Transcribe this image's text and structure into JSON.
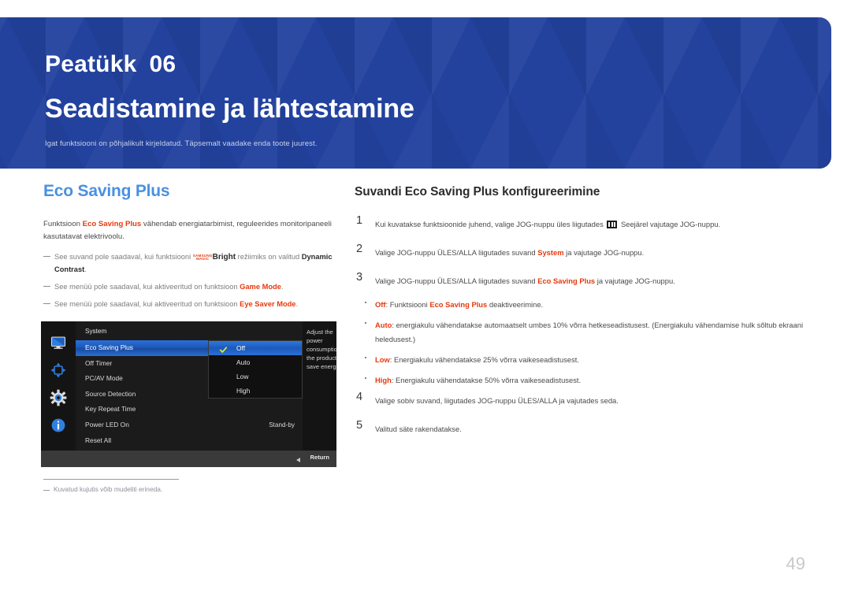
{
  "header": {
    "chapter_label": "Peatükk",
    "chapter_number": "06",
    "title": "Seadistamine ja lähtestamine",
    "subtitle": "Igat funktsiooni on põhjalikult kirjeldatud. Täpsemalt vaadake enda toote juurest.",
    "bg_color": "#23429e"
  },
  "left": {
    "heading": "Eco Saving Plus",
    "heading_color": "#4a90e2",
    "paragraph": {
      "p1": "Funktsioon ",
      "accent1": "Eco Saving Plus",
      "p2": " vähendab energiatarbimist, reguleerides monitoripaneeli kasutatavat elektrivoolu."
    },
    "notes": [
      {
        "pre": "See suvand pole saadaval, kui funktsiooni ",
        "logo_top": "SAMSUNG",
        "logo_bottom": "MAGIC",
        "logo_word": "Bright",
        "mid": " režiimiks on valitud ",
        "accent": "Dynamic Contrast",
        "post": "."
      },
      {
        "pre": "See menüü pole saadaval, kui aktiveeritud on funktsioon ",
        "accent": "Game Mode",
        "post": "."
      },
      {
        "pre": "See menüü pole saadaval, kui aktiveeritud on funktsioon ",
        "accent": "Eye Saver Mode",
        "post": "."
      }
    ],
    "footnote": "Kuvatud kujutis võib mudeliti erineda."
  },
  "osd": {
    "menu_title": "System",
    "items": [
      {
        "label": "Eco Saving Plus",
        "selected": true,
        "value": ""
      },
      {
        "label": "Off Timer",
        "selected": false,
        "value": ""
      },
      {
        "label": "PC/AV Mode",
        "selected": false,
        "value": ""
      },
      {
        "label": "Source Detection",
        "selected": false,
        "value": ""
      },
      {
        "label": "Key Repeat Time",
        "selected": false,
        "value": ""
      },
      {
        "label": "Power LED On",
        "selected": false,
        "value": "Stand-by"
      },
      {
        "label": "Reset All",
        "selected": false,
        "value": ""
      }
    ],
    "submenu": [
      {
        "label": "Off",
        "selected": true
      },
      {
        "label": "Auto",
        "selected": false
      },
      {
        "label": "Low",
        "selected": false
      },
      {
        "label": "High",
        "selected": false
      }
    ],
    "description": "Adjust the power consumption of the product to save energy.",
    "return_label": "Return",
    "icons": [
      "monitor-icon",
      "move-arrows-icon",
      "gear-icon",
      "info-icon"
    ]
  },
  "right": {
    "heading": "Suvandi Eco Saving Plus konfigureerimine",
    "steps": [
      {
        "num": "1",
        "pre": "Kui kuvatakse funktsioonide juhend, valige JOG-nuppu üles liigutades ",
        "glyph": "menu-icon",
        "post": " Seejärel vajutage JOG-nuppu."
      },
      {
        "num": "2",
        "pre": "Valige JOG-nuppu ÜLES/ALLA liigutades suvand ",
        "accent": "System",
        "post": " ja vajutage JOG-nuppu."
      },
      {
        "num": "3",
        "pre": "Valige JOG-nuppu ÜLES/ALLA liigutades suvand ",
        "accent": "Eco Saving Plus",
        "post": " ja vajutage JOG-nuppu."
      }
    ],
    "bullets": [
      {
        "accent": "Off",
        "pre": ": Funktsiooni ",
        "accent2": "Eco Saving Plus",
        "post": " deaktiveerimine."
      },
      {
        "accent": "Auto",
        "pre": ": energiakulu vähendatakse automaatselt umbes 10% võrra hetkeseadistusest. (Energiakulu vähendamise hulk sõltub ekraani heledusest.)",
        "accent2": "",
        "post": ""
      },
      {
        "accent": "Low",
        "pre": ": Energiakulu vähendatakse 25% võrra vaikeseadistusest.",
        "accent2": "",
        "post": ""
      },
      {
        "accent": "High",
        "pre": ": Energiakulu vähendatakse 50% võrra vaikeseadistusest.",
        "accent2": "",
        "post": ""
      }
    ],
    "steps_after": [
      {
        "num": "4",
        "text": "Valige sobiv suvand, liigutades JOG-nuppu ÜLES/ALLA ja vajutades seda."
      },
      {
        "num": "5",
        "text": "Valitud säte rakendatakse."
      }
    ]
  },
  "page_number": "49",
  "accent_color": "#e8380d"
}
